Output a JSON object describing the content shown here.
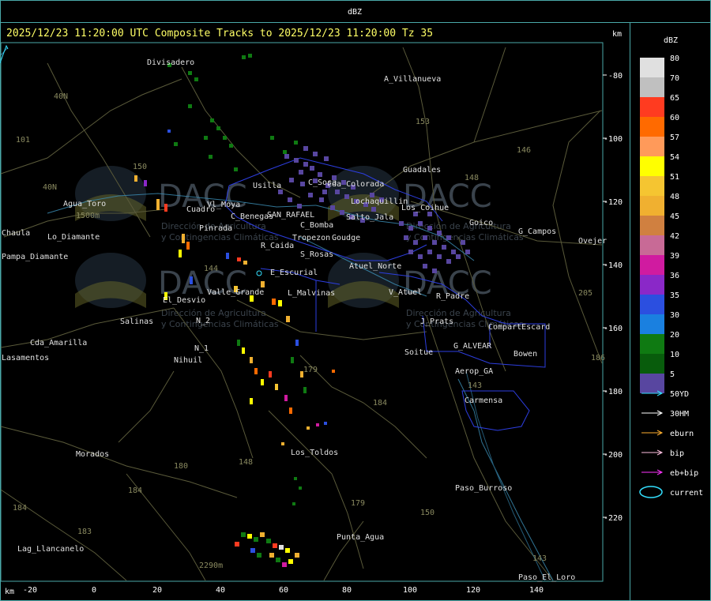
{
  "window_title": "dBZ",
  "map_title": "2025/12/23 11:20:00 UTC Composite Tracks to 2025/12/23 11:20:00 Tz 35",
  "km_label_right": "km",
  "km_label_bottom": "km",
  "x_axis_ticks": [
    "-20",
    "0",
    "20",
    "40",
    "60",
    "80",
    "100",
    "120",
    "140"
  ],
  "y_axis_ticks": [
    "-80",
    "-100",
    "-120",
    "-140",
    "-160",
    "-180",
    "-200",
    "-220"
  ],
  "legend": {
    "title": "dBZ",
    "levels": [
      {
        "label": "80",
        "color": "#e0e0e0"
      },
      {
        "label": "70",
        "color": "#c0c0c0"
      },
      {
        "label": "65",
        "color": "#ff3b20"
      },
      {
        "label": "60",
        "color": "#ff6a00"
      },
      {
        "label": "57",
        "color": "#ff9a5a"
      },
      {
        "label": "54",
        "color": "#ffff00"
      },
      {
        "label": "51",
        "color": "#f5c531"
      },
      {
        "label": "48",
        "color": "#f0b030"
      },
      {
        "label": "45",
        "color": "#d08040"
      },
      {
        "label": "42",
        "color": "#c86a96"
      },
      {
        "label": "39",
        "color": "#d01ba0"
      },
      {
        "label": "36",
        "color": "#8a28c8"
      },
      {
        "label": "35",
        "color": "#2b4fe0"
      },
      {
        "label": "30",
        "color": "#1a80e0"
      },
      {
        "label": "20",
        "color": "#0f7a12"
      },
      {
        "label": "10",
        "color": "#085c0c"
      },
      {
        "label": "5",
        "color": "#5846a0"
      }
    ],
    "tracks": [
      {
        "label": "50YD",
        "color": "#33e0ff"
      },
      {
        "label": "30HM",
        "color": "#ffffff"
      },
      {
        "label": "eburn",
        "color": "#ffb030"
      },
      {
        "label": "bip",
        "color": "#ffc0e0"
      },
      {
        "label": "eb+bip",
        "color": "#ff33ff"
      },
      {
        "label": "current",
        "color": "#33e0ff"
      }
    ]
  },
  "places": [
    {
      "name": "Divisadero"
    },
    {
      "name": "A_Villanueva"
    },
    {
      "name": "Guadales"
    },
    {
      "name": "Usilla"
    },
    {
      "name": "C_Sosa"
    },
    {
      "name": "Vl_Moya"
    },
    {
      "name": "C_Benegas"
    },
    {
      "name": "SAN_RAFAEL"
    },
    {
      "name": "C_Bomba"
    },
    {
      "name": "Pinrada"
    },
    {
      "name": "Cuadro"
    },
    {
      "name": "R_Caida"
    },
    {
      "name": "Tropezon"
    },
    {
      "name": "Goudge"
    },
    {
      "name": "S_Rosas"
    },
    {
      "name": "Atuel_Norte"
    },
    {
      "name": "E_Escurial"
    },
    {
      "name": "El_Desvio"
    },
    {
      "name": "Valle_Grande"
    },
    {
      "name": "L_Malvinas"
    },
    {
      "name": "V_Atuel"
    },
    {
      "name": "R_Padre"
    },
    {
      "name": "J_Prats"
    },
    {
      "name": "CompartEscard"
    },
    {
      "name": "G_ALVEAR"
    },
    {
      "name": "Bowen"
    },
    {
      "name": "Soitue"
    },
    {
      "name": "Aerop_GA"
    },
    {
      "name": "Carmensa"
    },
    {
      "name": "Salinas"
    },
    {
      "name": "Cda_Amarilla"
    },
    {
      "name": "Nihuil"
    },
    {
      "name": "Los_Toldos"
    },
    {
      "name": "Morados"
    },
    {
      "name": "Punta_Agua"
    },
    {
      "name": "Paso_Burroso"
    },
    {
      "name": "Lag_Llancanelo"
    },
    {
      "name": "Paso_El_Loro"
    },
    {
      "name": "Goico"
    },
    {
      "name": "G_Campos"
    },
    {
      "name": "Ovejer"
    },
    {
      "name": "Agua_Toro"
    },
    {
      "name": "Pampa_Diamante"
    },
    {
      "name": "Los_Coihue"
    },
    {
      "name": "Lochaquillin"
    },
    {
      "name": "Salto_Jala"
    },
    {
      "name": "Cda_Colorada"
    },
    {
      "name": "N_2"
    },
    {
      "name": "N_1"
    },
    {
      "name": "Lasamentos"
    },
    {
      "name": "Chaula"
    },
    {
      "name": "Lo_Diamante"
    }
  ],
  "road_labels": [
    "40N",
    "40N",
    "101",
    "150",
    "153",
    "146",
    "148",
    "144",
    "179",
    "184",
    "180",
    "184",
    "179",
    "150",
    "143",
    "143",
    "205",
    "184",
    "183",
    "148",
    "186",
    "2290m",
    "1500m"
  ],
  "watermark": {
    "brand": "DACC",
    "line1": "Dirección de Agricultura",
    "line2": "y Contingencias Climáticas"
  }
}
